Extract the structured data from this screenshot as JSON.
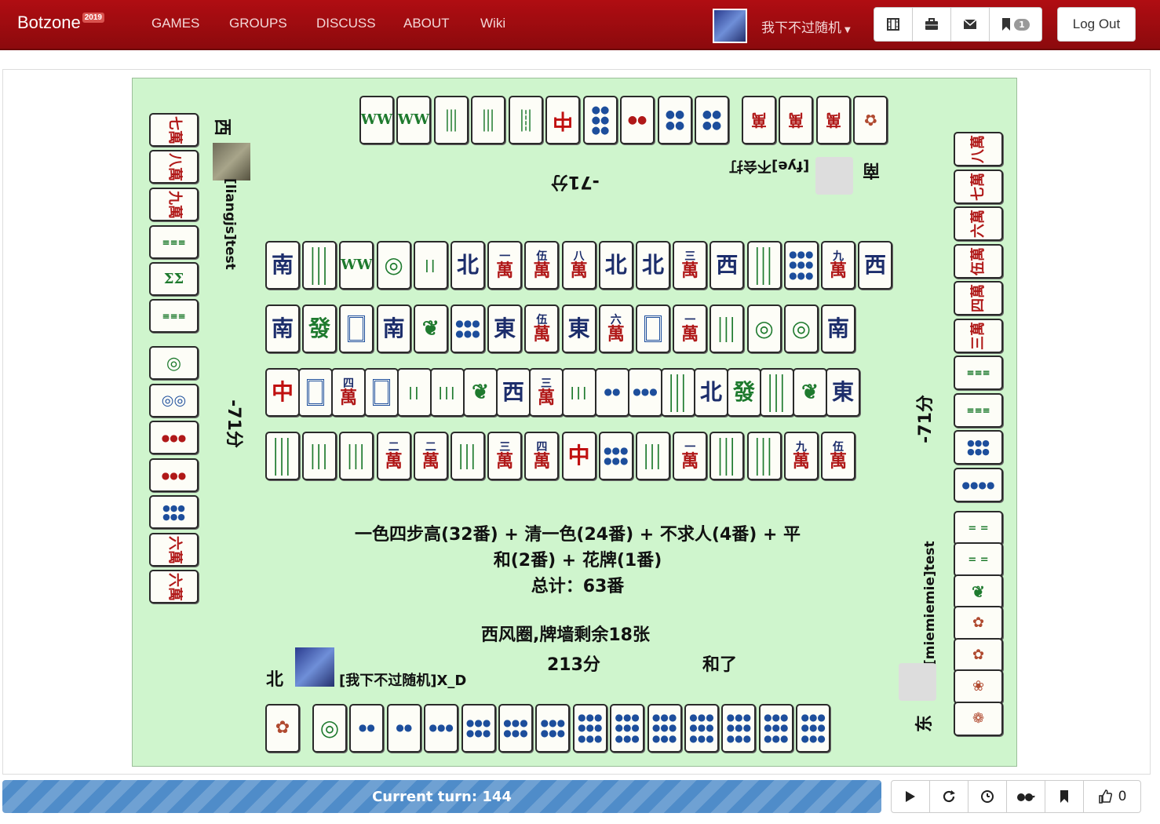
{
  "navbar": {
    "brand": "Botzone",
    "brand_year": "2019",
    "links": [
      "GAMES",
      "GROUPS",
      "DISCUSS",
      "ABOUT",
      "Wiki"
    ],
    "user_name": "我下不过随机",
    "message_count": "1",
    "logout_label": "Log Out",
    "icons": [
      "film-icon",
      "briefcase-icon",
      "envelope-icon",
      "bookmark-icon"
    ]
  },
  "players": {
    "west": {
      "seat": "西",
      "name": "[liangjs]test",
      "score": "-71分"
    },
    "south": {
      "seat": "南",
      "name": "[fye]不会打",
      "score": "-71分"
    },
    "east": {
      "seat": "东",
      "name": "[miemiemie]test",
      "score": "-71分"
    },
    "north": {
      "seat": "北",
      "name": "[我下不过随机]X_D",
      "score": "213分",
      "status": "和了"
    }
  },
  "result": {
    "fan_line1": "一色四步高(32番) + 清一色(24番) + 不求人(4番) + 平",
    "fan_line2": "和(2番) + 花牌(1番)",
    "total": "总计：63番",
    "round_info": "西风圈,牌墙剩余18张"
  },
  "tiles": {
    "top_hand": [
      "W",
      "W",
      "8s",
      "8s",
      "6s",
      "中",
      "8p",
      "5p",
      "5p",
      "4p"
    ],
    "top_flowers": [
      "九萬",
      "八萬",
      "七萬",
      "3"
    ],
    "left_melds": [
      "七萬",
      "八萬",
      "九萬",
      "6s",
      "5s",
      "6s"
    ],
    "left_hand": [
      "1p",
      "2p",
      "5p",
      "6p",
      "7p",
      "六萬",
      "六萬"
    ],
    "right_melds": [
      "八萬",
      "七萬",
      "六萬",
      "伍萬",
      "四萬",
      "三萬",
      "6s",
      "6s",
      "9p",
      "8p"
    ],
    "right_hand": [
      "2s",
      "2s",
      "1s",
      "春",
      "夏",
      "秋",
      "冬",
      "4"
    ],
    "discard_row1": [
      "南",
      "9s",
      "W",
      "1p",
      "2s",
      "北",
      "一萬",
      "伍萬",
      "八萬",
      "北",
      "北",
      "三萬",
      "西",
      "8s",
      "8p",
      "九萬",
      "西"
    ],
    "discard_row2": [
      "南",
      "發",
      "白",
      "南",
      "1s",
      "4p",
      "東",
      "伍萬",
      "東",
      "六萬",
      "白",
      "一萬",
      "6s",
      "1p",
      "1p",
      "南"
    ],
    "discard_row3": [
      "中",
      "白",
      "四萬",
      "白",
      "2s",
      "3s",
      "1s",
      "西",
      "三萬",
      "3s",
      "2p",
      "3p",
      "9s",
      "北",
      "發",
      "9s",
      "1s",
      "東"
    ],
    "discard_row4": [
      "9s",
      "4s",
      "6s",
      "二萬",
      "二萬",
      "6s",
      "三萬",
      "四萬",
      "中",
      "4p",
      "6s",
      "一萬",
      "8s",
      "9s",
      "九萬",
      "伍萬"
    ],
    "bottom_hand": [
      "2",
      "1p",
      "2p",
      "2p",
      "3p",
      "4p",
      "5p",
      "6p",
      "7p",
      "7p",
      "7p",
      "8p",
      "8p",
      "9p",
      "9p"
    ]
  },
  "footer": {
    "turn_label": "Current turn: 144",
    "like_count": "0",
    "controls": [
      "play-icon",
      "replay-icon",
      "timer-icon",
      "spectate-icon",
      "bookmark-icon",
      "like-icon"
    ]
  }
}
